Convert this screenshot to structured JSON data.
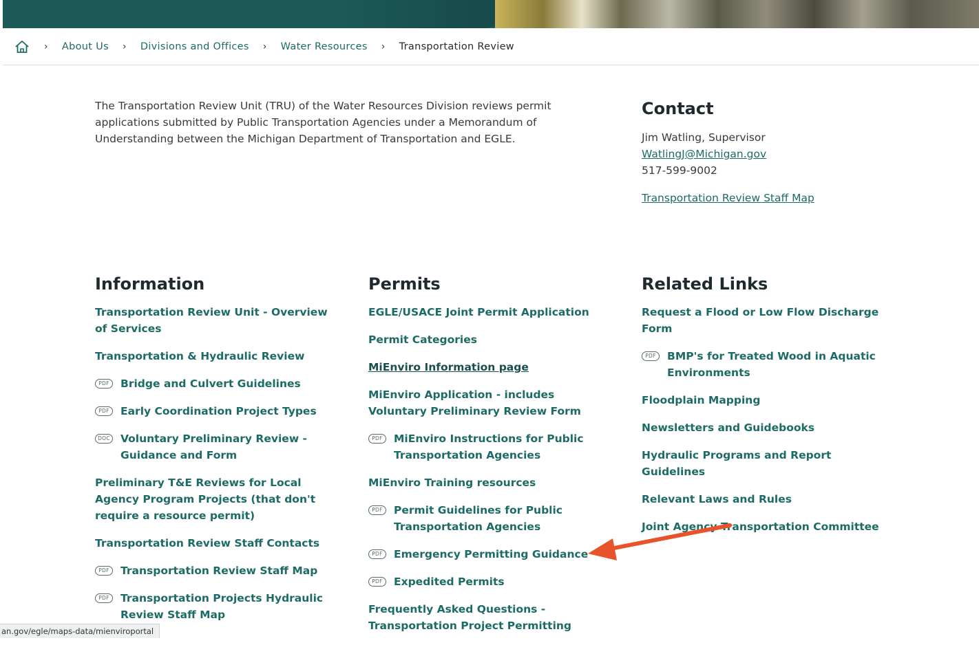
{
  "breadcrumb": {
    "items": [
      "About Us",
      "Divisions and Offices",
      "Water Resources"
    ],
    "current": "Transportation Review"
  },
  "intro": "The Transportation Review Unit (TRU) of the Water Resources Division reviews permit applications submitted by Public Transportation Agencies under a Memorandum of Understanding between the Michigan Department of Transportation and EGLE.",
  "contact": {
    "title": "Contact",
    "name": "Jim Watling, Supervisor",
    "email": "WatlingJ@Michigan.gov",
    "phone": "517-599-9002",
    "map_link": "Transportation Review Staff Map"
  },
  "information": {
    "title": "Information",
    "links": [
      {
        "label": "Transportation Review Unit - Overview of Services",
        "badge": ""
      },
      {
        "label": "Transportation & Hydraulic Review",
        "badge": ""
      },
      {
        "label": "Bridge and Culvert Guidelines",
        "badge": "PDF"
      },
      {
        "label": "Early Coordination Project Types",
        "badge": "PDF"
      },
      {
        "label": "Voluntary Preliminary Review - Guidance and Form",
        "badge": "DOC"
      },
      {
        "label": "Preliminary T&E Reviews for Local Agency Program Projects (that don't require a resource permit)",
        "badge": ""
      },
      {
        "label": "Transportation Review Staff Contacts",
        "badge": ""
      },
      {
        "label": "Transportation Review Staff Map",
        "badge": "PDF"
      },
      {
        "label": "Transportation Projects Hydraulic Review Staff Map",
        "badge": "PDF"
      }
    ]
  },
  "permits": {
    "title": "Permits",
    "links": [
      {
        "label": "EGLE/USACE Joint Permit Application",
        "badge": ""
      },
      {
        "label": "Permit Categories",
        "badge": ""
      },
      {
        "label": "MiEnviro Information page",
        "badge": "",
        "underline": true
      },
      {
        "label": "MiEnviro Application - includes Voluntary Preliminary Review Form",
        "badge": ""
      },
      {
        "label": "MiEnviro Instructions for Public Transportation Agencies",
        "badge": "PDF"
      },
      {
        "label": "MiEnviro Training resources",
        "badge": ""
      },
      {
        "label": "Permit Guidelines for Public Transportation Agencies",
        "badge": "PDF"
      },
      {
        "label": "Emergency Permitting Guidance",
        "badge": "PDF"
      },
      {
        "label": "Expedited Permits",
        "badge": "PDF"
      },
      {
        "label": "Frequently Asked Questions - Transportation Project Permitting",
        "badge": ""
      }
    ]
  },
  "related": {
    "title": "Related Links",
    "links": [
      {
        "label": "Request a Flood or Low Flow Discharge Form",
        "badge": ""
      },
      {
        "label": "BMP's for Treated Wood in Aquatic Environments",
        "badge": "PDF"
      },
      {
        "label": "Floodplain Mapping",
        "badge": ""
      },
      {
        "label": "Newsletters and Guidebooks",
        "badge": ""
      },
      {
        "label": "Hydraulic Programs and Report Guidelines",
        "badge": ""
      },
      {
        "label": "Relevant Laws and Rules",
        "badge": ""
      },
      {
        "label": "Joint Agency Transportation Committee",
        "badge": ""
      }
    ]
  },
  "status_url": "an.gov/egle/maps-data/mienviroportal",
  "colors": {
    "link": "#1d6b66",
    "banner": "#1e5e5b",
    "arrow": "#e8542a"
  },
  "icons": {
    "home": "home-icon",
    "separator": "chevron-right-icon",
    "badge": "file-type-badge",
    "annotation": "red-arrow"
  }
}
